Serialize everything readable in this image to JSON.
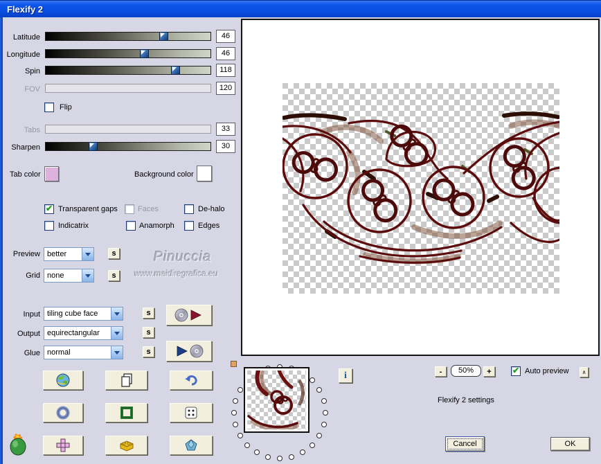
{
  "window": {
    "title": "Flexify 2"
  },
  "theme": {
    "dialog_bg": "#d6d6e4",
    "titlebar_blue": "#0c55e8",
    "button_face": "#f2efdf",
    "ornament_color": "#5c0c0c",
    "ornament_accent": "#7d4c34",
    "tab_color": "#ddb2dd",
    "background_color": "#ffffff",
    "check_green": "#1f9e1f"
  },
  "sliders": [
    {
      "label": "Latitude",
      "value": "46",
      "percent": 72,
      "disabled": false
    },
    {
      "label": "Longitude",
      "value": "46",
      "percent": 60,
      "disabled": false
    },
    {
      "label": "Spin",
      "value": "118",
      "percent": 79,
      "disabled": false
    },
    {
      "label": "FOV",
      "value": "120",
      "percent": 0,
      "disabled": true
    },
    {
      "label": "Tabs",
      "value": "33",
      "percent": 0,
      "disabled": true
    },
    {
      "label": "Sharpen",
      "value": "30",
      "percent": 29,
      "disabled": false
    }
  ],
  "flip": {
    "label": "Flip",
    "checked": false
  },
  "color_pickers": {
    "tab_label": "Tab color",
    "background_label": "Background color"
  },
  "checkboxes": [
    {
      "label": "Transparent gaps",
      "checked": true,
      "disabled": false
    },
    {
      "label": "Faces",
      "checked": false,
      "disabled": true
    },
    {
      "label": "De-halo",
      "checked": false,
      "disabled": false
    },
    {
      "label": "Indicatrix",
      "checked": false,
      "disabled": false
    },
    {
      "label": "Anamorph",
      "checked": false,
      "disabled": false
    },
    {
      "label": "Edges",
      "checked": false,
      "disabled": false
    }
  ],
  "dropdowns": [
    {
      "label": "Preview",
      "value": "better"
    },
    {
      "label": "Grid",
      "value": "none"
    },
    {
      "label": "Input",
      "value": "tiling cube face"
    },
    {
      "label": "Output",
      "value": "equirectangular"
    },
    {
      "label": "Glue",
      "value": "normal"
    }
  ],
  "s_button_label": "s",
  "watermark": {
    "line1": "Pinuccia",
    "line2": "www.maidiregrafica.eu"
  },
  "grid_buttons": [
    {
      "icon": "globe-icon"
    },
    {
      "icon": "copy-pages-icon"
    },
    {
      "icon": "undo-arrow-icon"
    },
    {
      "icon": "torus-icon"
    },
    {
      "icon": "frame-icon"
    },
    {
      "icon": "dice-icon"
    },
    {
      "icon": "cube-net-icon"
    },
    {
      "icon": "bricks-icon"
    },
    {
      "icon": "polyhedron-icon"
    }
  ],
  "cd_buttons": {
    "load_icon": "cd-and-red-play",
    "save_icon": "blue-play-and-cd"
  },
  "info_button_label": "i",
  "up_button_label": "∧",
  "zoom_controls": {
    "minus": "-",
    "level": "50%",
    "plus": "+"
  },
  "auto_preview": {
    "label": "Auto preview",
    "checked": true
  },
  "settings_text": "Flexify 2 settings",
  "actions": {
    "cancel": "Cancel",
    "ok": "OK"
  }
}
